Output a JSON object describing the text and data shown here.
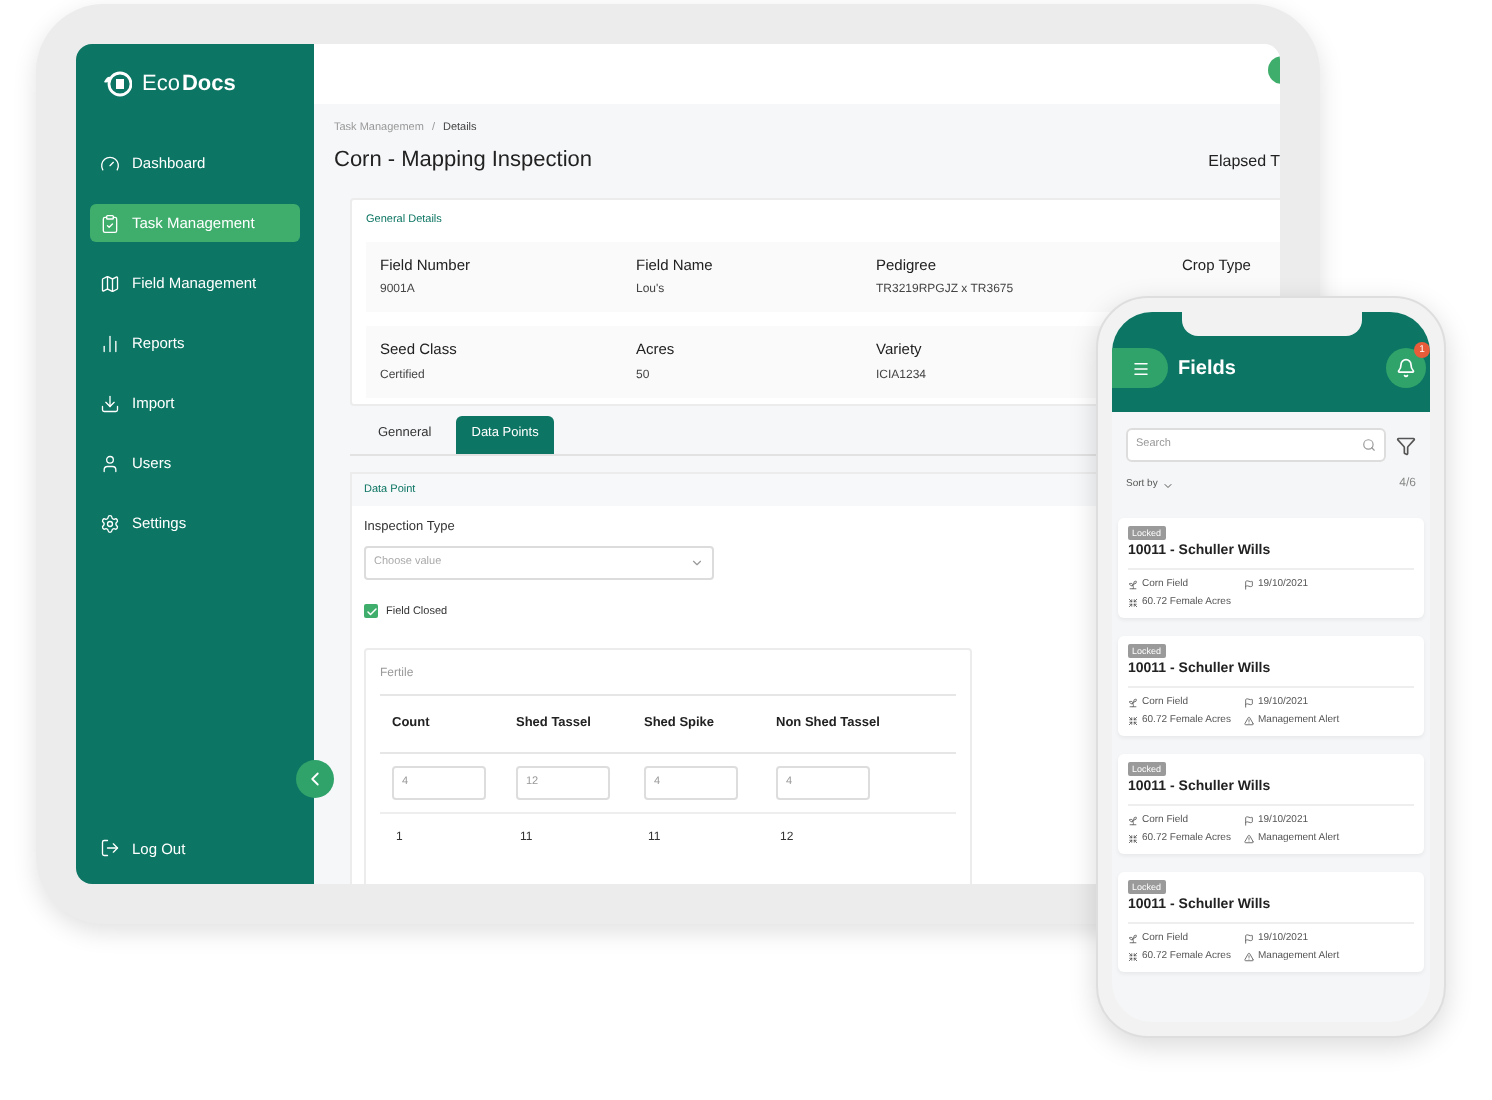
{
  "sidebar": {
    "logo": {
      "light": "Eco",
      "bold": "Docs"
    },
    "items": [
      {
        "label": "Dashboard",
        "selected": false
      },
      {
        "label": "Task Management",
        "selected": true
      },
      {
        "label": "Field Management",
        "selected": false
      },
      {
        "label": "Reports",
        "selected": false
      },
      {
        "label": "Import",
        "selected": false
      },
      {
        "label": "Users",
        "selected": false
      },
      {
        "label": "Settings",
        "selected": false
      }
    ],
    "logout": "Log Out"
  },
  "breadcrumb": {
    "parent": "Task Managemem",
    "separator": "/",
    "current": "Details"
  },
  "title": "Corn - Mapping Inspection",
  "elapsed": "Elapsed T",
  "general_details": {
    "heading": "General Details",
    "rows": [
      [
        {
          "label": "Field Number",
          "value": "9001A"
        },
        {
          "label": "Field Name",
          "value": "Lou's"
        },
        {
          "label": "Pedigree",
          "value": "TR3219RPGJZ x TR3675"
        },
        {
          "label": "Crop Type"
        }
      ],
      [
        {
          "label": "Seed Class",
          "value": "Certified"
        },
        {
          "label": "Acres",
          "value": "50"
        },
        {
          "label": "Variety",
          "value": "ICIA1234"
        }
      ]
    ]
  },
  "tabs": [
    {
      "label": "Genneral",
      "selected": false
    },
    {
      "label": "Data Points",
      "selected": true
    }
  ],
  "data_point": {
    "heading": "Data Point",
    "inspection_type": {
      "label": "Inspection Type",
      "placeholder": "Choose value"
    },
    "field_closed": {
      "label": "Field Closed",
      "checked": true
    },
    "table": {
      "title": "Fertile",
      "columns": [
        "Count",
        "Shed Tassel",
        "Shed Spike",
        "Non Shed Tassel"
      ],
      "inputs": [
        "4",
        "12",
        "4",
        "4"
      ],
      "rows": [
        [
          "1",
          "11",
          "11",
          "12"
        ]
      ]
    }
  },
  "phone": {
    "title": "Fields",
    "notifications": "1",
    "search": {
      "placeholder": "Search"
    },
    "sort": "Sort by",
    "count": "4/6",
    "cards": [
      {
        "badge": "Locked",
        "title": "10011 - Schuller Wills",
        "crop": "Corn Field",
        "date": "19/10/2021",
        "acres": "60.72 Female Acres"
      },
      {
        "badge": "Locked",
        "title": "10011 - Schuller Wills",
        "crop": "Corn Field",
        "date": "19/10/2021",
        "acres": "60.72 Female Acres",
        "alert": "Management Alert"
      },
      {
        "badge": "Locked",
        "title": "10011 - Schuller Wills",
        "crop": "Corn Field",
        "date": "19/10/2021",
        "acres": "60.72 Female Acres",
        "alert": "Management Alert"
      },
      {
        "badge": "Locked",
        "title": "10011 - Schuller Wills",
        "crop": "Corn Field",
        "date": "19/10/2021",
        "acres": "60.72 Female Acres",
        "alert": "Management Alert"
      }
    ]
  }
}
